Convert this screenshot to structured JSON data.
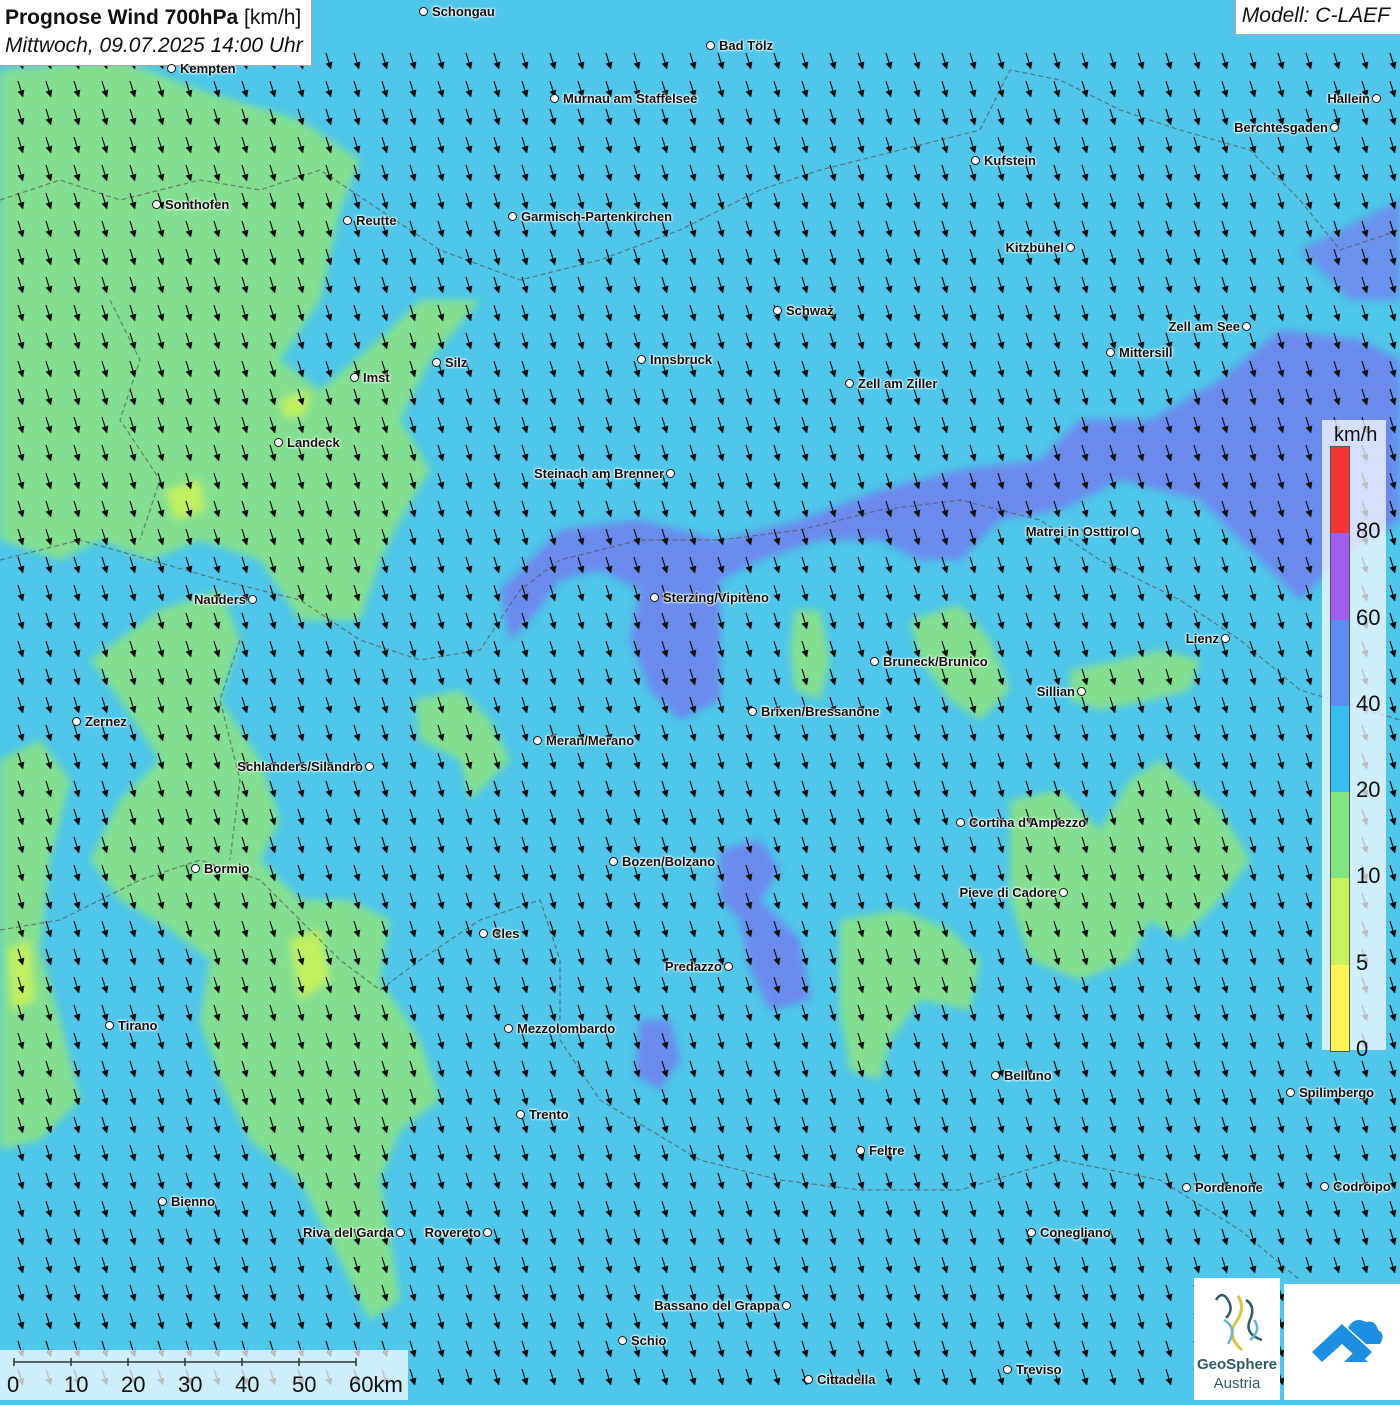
{
  "title": {
    "main": "Prognose Wind 700hPa",
    "unit": "[km/h]",
    "datetime": "Mittwoch, 09.07.2025 14:00 Uhr"
  },
  "model_label": "Modell: C-LAEF",
  "cities": [
    {
      "name": "Schongau",
      "label_side": "right"
    },
    {
      "name": "Bad Tölz",
      "label_side": "right"
    },
    {
      "name": "Kempten",
      "label_side": "right"
    },
    {
      "name": "Murnau am Staffelsee",
      "label_side": "right"
    },
    {
      "name": "Hallein",
      "label_side": "left"
    },
    {
      "name": "Berchtesgaden",
      "label_side": "left"
    },
    {
      "name": "Kufstein",
      "label_side": "right"
    },
    {
      "name": "Sonthofen",
      "label_side": "right"
    },
    {
      "name": "Reutte",
      "label_side": "right"
    },
    {
      "name": "Garmisch-Partenkirchen",
      "label_side": "right"
    },
    {
      "name": "Kitzbühel",
      "label_side": "left"
    },
    {
      "name": "Schwaz",
      "label_side": "right"
    },
    {
      "name": "Zell am See",
      "label_side": "left"
    },
    {
      "name": "Mittersill",
      "label_side": "right"
    },
    {
      "name": "Innsbruck",
      "label_side": "right"
    },
    {
      "name": "Silz",
      "label_side": "right"
    },
    {
      "name": "Imst",
      "label_side": "right"
    },
    {
      "name": "Zell am Ziller",
      "label_side": "right"
    },
    {
      "name": "Landeck",
      "label_side": "right"
    },
    {
      "name": "Steinach am Brenner",
      "label_side": "left"
    },
    {
      "name": "Matrei in Osttirol",
      "label_side": "left"
    },
    {
      "name": "Nauders",
      "label_side": "left"
    },
    {
      "name": "Sterzing/Vipiteno",
      "label_side": "right"
    },
    {
      "name": "Lienz",
      "label_side": "left"
    },
    {
      "name": "Bruneck/Brunico",
      "label_side": "right"
    },
    {
      "name": "Sillian",
      "label_side": "left"
    },
    {
      "name": "Brixen/Bressanone",
      "label_side": "right"
    },
    {
      "name": "Zernez",
      "label_side": "right"
    },
    {
      "name": "Meran/Merano",
      "label_side": "right"
    },
    {
      "name": "Schlanders/Silandro",
      "label_side": "left"
    },
    {
      "name": "Cortina d'Ampezzo",
      "label_side": "right"
    },
    {
      "name": "Bozen/Bolzano",
      "label_side": "right"
    },
    {
      "name": "Bormio",
      "label_side": "right"
    },
    {
      "name": "Pieve di Cadore",
      "label_side": "left"
    },
    {
      "name": "Cles",
      "label_side": "right"
    },
    {
      "name": "Predazzo",
      "label_side": "left"
    },
    {
      "name": "Tirano",
      "label_side": "right"
    },
    {
      "name": "Mezzolombardo",
      "label_side": "right"
    },
    {
      "name": "Belluno",
      "label_side": "right"
    },
    {
      "name": "Spilimbergo",
      "label_side": "right"
    },
    {
      "name": "Trento",
      "label_side": "right"
    },
    {
      "name": "Feltre",
      "label_side": "right"
    },
    {
      "name": "Pordenone",
      "label_side": "right"
    },
    {
      "name": "Codroipo",
      "label_side": "right"
    },
    {
      "name": "Bienno",
      "label_side": "right"
    },
    {
      "name": "Riva del Garda",
      "label_side": "left"
    },
    {
      "name": "Rovereto",
      "label_side": "left"
    },
    {
      "name": "Conegliano",
      "label_side": "right"
    },
    {
      "name": "Bassano del Grappa",
      "label_side": "left"
    },
    {
      "name": "Schio",
      "label_side": "right"
    },
    {
      "name": "Treviso",
      "label_side": "right"
    },
    {
      "name": "Cittadella",
      "label_side": "right"
    }
  ],
  "legend": {
    "unit": "km/h",
    "ticks": [
      "0",
      "5",
      "10",
      "20",
      "40",
      "60",
      "80"
    ],
    "colors": [
      "#fff455",
      "#c9f25a",
      "#7fe57c",
      "#35bff0",
      "#5a8ef0",
      "#9f5ef0",
      "#f53535"
    ]
  },
  "wind_field": {
    "direction": "north-west wind (arrows pointing south-east)",
    "background_color": "#4fc6ea",
    "zones": [
      {
        "level": "10-20 km/h",
        "color": "#86e08a",
        "region": "west (Allgäu, Landeck, Vinschgau, Lombardy)"
      },
      {
        "level": "10-20 km/h",
        "color": "#86e08a",
        "region": "Dolomites south-east (Cortina, Cadore, Belluno)"
      },
      {
        "level": "40-60 km/h",
        "color": "#5a8ef0",
        "region": "Main Alpine ridge (Brenner, Hohe Tauern, Zell am See)"
      },
      {
        "level": "5-10 km/h",
        "color": "#c9f25a",
        "region": "small patches near Landeck, Riva, Tirano"
      }
    ]
  },
  "scale_bar": {
    "labels": [
      "0",
      "10",
      "20",
      "30",
      "40",
      "50",
      "60km"
    ]
  },
  "logos": {
    "geosphere_line1": "GeoSphere",
    "geosphere_line2": "Austria",
    "second_logo_icon": "cloud-arrow-icon"
  }
}
